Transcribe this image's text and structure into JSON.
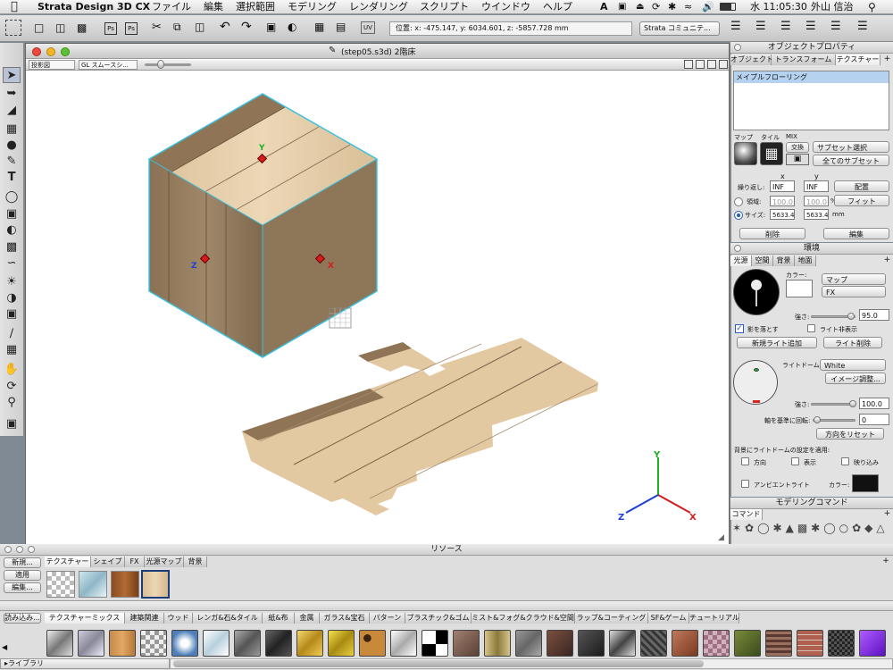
{
  "menubar": {
    "app": "Strata Design 3D CX",
    "items": [
      "ファイル",
      "編集",
      "選択範囲",
      "モデリング",
      "レンダリング",
      "スクリプト",
      "ウインドウ",
      "ヘルプ"
    ],
    "clock": "水 11:05:30",
    "user": "外山 信治"
  },
  "toolbar": {
    "position": "位置: x: -475.147, y: 6034.601, z: -5857.728 mm",
    "community": "Strata コミュニテ..."
  },
  "document": {
    "title": "(step05.s3d) 2階床",
    "view_select": "投影図",
    "render_select": "GL スムースシ..."
  },
  "axes": {
    "y": "Y",
    "z": "Z",
    "x": "X"
  },
  "obj_panel": {
    "title": "オブジェクトプロパティ",
    "tabs": [
      "オブジェクト",
      "トランスフォーム",
      "テクスチャー"
    ],
    "texture_item": "メイプルフローリング",
    "map_label": "マップ",
    "tile_label": "タイル",
    "mix_label": "MIX",
    "swap_label": "交換",
    "subset_select": "サブセット選択",
    "all_subsets": "全てのサブセット",
    "x_hdr": "x",
    "y_hdr": "y",
    "repeat_label": "繰り返し:",
    "repeat_x": "INF",
    "repeat_y": "INF",
    "place_btn": "配置",
    "area_label": "領域:",
    "area_x": "100.0",
    "area_y": "100.0",
    "pct": "%",
    "fit_btn": "フィット",
    "size_label": "サイズ:",
    "size_x": "5633.4",
    "size_y": "5633.4",
    "mm": "mm",
    "delete_btn": "削除",
    "edit_btn": "編集"
  },
  "env_panel": {
    "title": "環境",
    "tabs": [
      "光源",
      "空間",
      "背景",
      "地面"
    ],
    "color_label": "カラー:",
    "map_select": "マップ",
    "fx_select": "FX",
    "strength_label": "強さ:",
    "strength_value": "95.0",
    "shadow_label": "影を落とす",
    "hide_light_label": "ライト非表示",
    "add_light_btn": "新規ライト追加",
    "delete_light_btn": "ライト削除",
    "dome_label": "ライトドーム:",
    "dome_select": "White",
    "image_adjust_btn": "イメージ調整...",
    "dome_strength_label": "強さ:",
    "dome_strength_value": "100.0",
    "rotate_label": "軸を基準に回転:",
    "rotate_value": "0",
    "reset_btn": "方向をリセット",
    "apply_label": "背景にライトドームの設定を適用:",
    "dir_label": "方向",
    "display_label": "表示",
    "reflect_label": "映り込み",
    "ambient_label": "アンビエントライト",
    "ambient_color_label": "カラー:"
  },
  "modeling_panel": {
    "title": "モデリングコマンド",
    "tab": "コマンド"
  },
  "resources": {
    "title": "リソース",
    "new_btn": "新規...",
    "apply_btn": "適用",
    "edit_btn": "編集...",
    "tabs": [
      "テクスチャー",
      "シェイプ",
      "FX",
      "光源マップ",
      "背景"
    ],
    "load_btn": "読み込み...",
    "library_label": "ライブラリ",
    "lib_tabs": [
      "テクスチャーミックス",
      "建築関連",
      "ウッド",
      "レンガ&石&タイル",
      "紙&布",
      "金属",
      "ガラス&宝石",
      "パターン",
      "プラスチック&ゴム",
      "ミスト&フォグ&クラウド&空間",
      "ラップ&コーティング",
      "SF&ゲーム",
      "チュートリアル"
    ]
  },
  "colors": {
    "wood_light": "#e3c9a2",
    "wood_dark": "#8f7556",
    "selection": "#3ac0e0",
    "axis_x": "#d21d1d",
    "axis_y": "#19b41f",
    "axis_z": "#1d3fd2"
  }
}
